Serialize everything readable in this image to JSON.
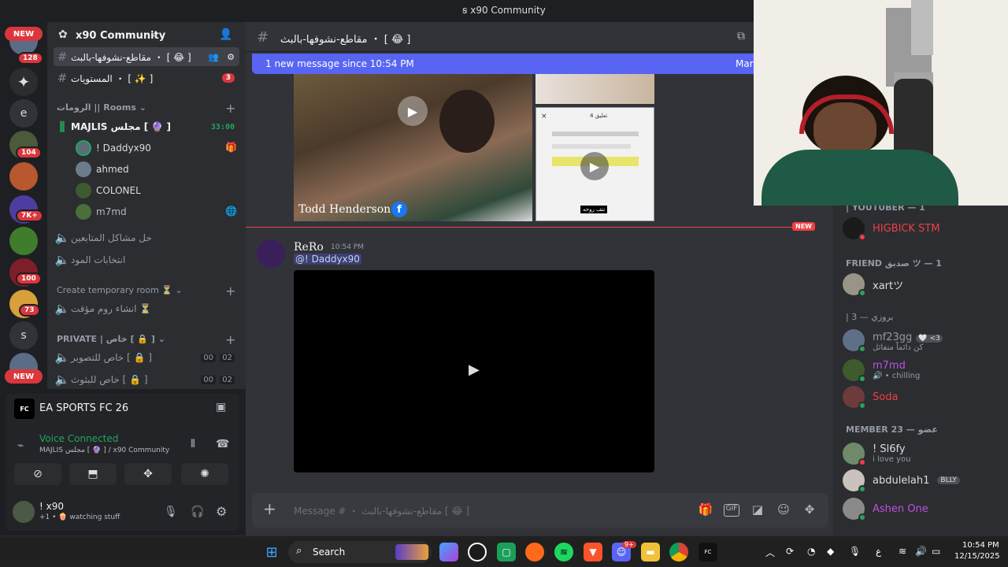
{
  "window": {
    "title": "x90 Community"
  },
  "rail": {
    "new_top": "NEW",
    "new_bottom": "NEW",
    "badges": [
      "128",
      "104",
      "7K+",
      "100",
      "73"
    ],
    "letters": [
      "e",
      "s"
    ]
  },
  "server": {
    "name": "x90 Community",
    "channels_top": [
      {
        "name": "مقاطع-نشوفها-بالبث ・ [ 😂 ]"
      },
      {
        "name": "المستويات ・ [ ✨ ]",
        "badge": "3"
      }
    ],
    "rooms_category": "الرومات || Rooms",
    "majlis": {
      "name": "MAJLIS مجلس [ 🔮 ]",
      "timer": "33:00"
    },
    "voice_users": [
      "! Daddyx90",
      "ahmed",
      "COLONEL",
      "m7md"
    ],
    "voice_channels": [
      "حل مشاكل المتابعين",
      "انتخابات المود"
    ],
    "temp_category": "Create temporary room ⏳",
    "temp_channels": [
      "انشاء روم مؤقت ⏳"
    ],
    "private_category": "PRIVATE | خاص [ 🔒 ]",
    "private_channels": [
      {
        "name": "خاص للتصوير [ 🔒 ]",
        "a": "00",
        "b": "02"
      },
      {
        "name": "خاص للبثوث [ 🔒 ]",
        "a": "00",
        "b": "02"
      }
    ]
  },
  "game": {
    "name": "EA SPORTS FC 26"
  },
  "voice": {
    "status": "Voice Connected",
    "location": "MAJLIS مجلس [ 🔮 ] / x90 Community"
  },
  "user": {
    "name": "! x90",
    "status": "+1 • 🍿 watching stuff"
  },
  "chat": {
    "channel_name": "مقاطع-نشوفها-بالبث ・ [ 😂 ]",
    "new_banner": "1 new message since 10:54 PM",
    "mark_read": "Mark",
    "new_divider": "NEW",
    "media_caption": "Todd Henderson",
    "message": {
      "author": "ReRo",
      "time": "10:54 PM",
      "mention": "@! Daddyx90"
    },
    "composer_placeholder": "Message # ・ مقاطع-نشوفها-بالبث [ 😂 ]",
    "phone_button": "نتف روحه",
    "phone_header": "4 تعليق"
  },
  "members": {
    "youtuber_cat": "| YOUTUBER — 1",
    "youtuber": [
      {
        "name": "HIGBICK STM",
        "color": "#f23f43"
      }
    ],
    "friend_cat": "FRIEND صديق ツ — 1",
    "friends": [
      {
        "name": "xartツ",
        "color": "#dbdee1"
      }
    ],
    "brozi_cat": "| 3 — بروزي",
    "brozi": [
      {
        "name": "mf23gg",
        "sub": "كن دائماً متفائل",
        "tag": "🤍 <3",
        "color": "#949ba4"
      },
      {
        "name": "m7md",
        "sub": "chilling",
        "color": "#c050e0"
      },
      {
        "name": "Soda",
        "color": "#f23f43"
      }
    ],
    "member_cat": "MEMBER 23 — عضو",
    "member": [
      {
        "name": "! Sl6fy",
        "sub": "i love you",
        "color": "#dbdee1"
      },
      {
        "name": "abdulelah1",
        "tag": "BLLY",
        "color": "#dbdee1"
      },
      {
        "name": "Ashen One",
        "color": "#c050e0"
      }
    ]
  },
  "taskbar": {
    "search": "Search",
    "time": "10:54 PM",
    "date": "12/15/2025",
    "discord_badge": "9+"
  },
  "colors": {
    "accent": "#5865f2",
    "danger": "#da373c",
    "online": "#23a55a"
  }
}
